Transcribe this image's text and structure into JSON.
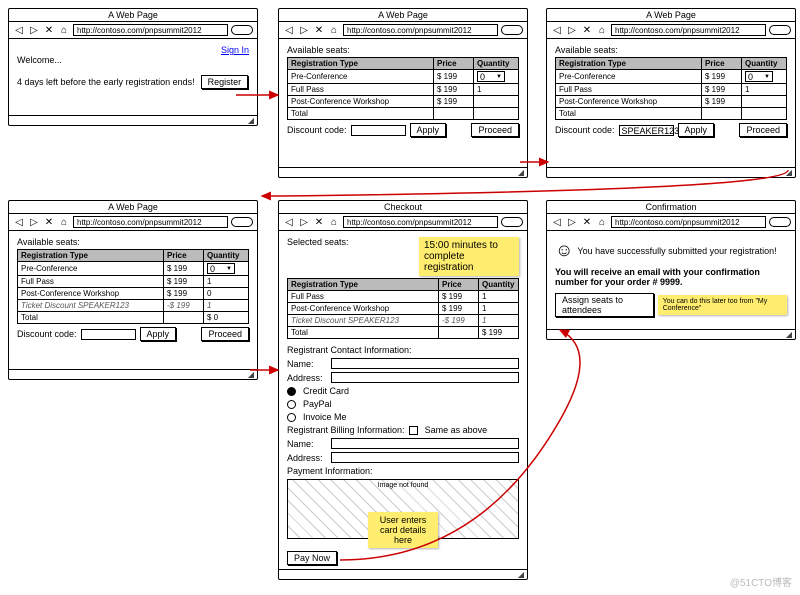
{
  "common": {
    "title_web": "A Web Page",
    "title_checkout": "Checkout",
    "title_confirm": "Confirmation",
    "url": "http://contoso.com/pnpsummit2012",
    "avail": "Available seats:",
    "col_type": "Registration Type",
    "col_price": "Price",
    "col_qty": "Quantity",
    "pre": "Pre-Conference",
    "full": "Full Pass",
    "post": "Post-Conference Workshop",
    "price199": "$ 199",
    "neg199": "-$ 199",
    "total": "Total",
    "discount": "Discount code:",
    "apply": "Apply",
    "proceed": "Proceed",
    "sel0": "0",
    "qty1": "1",
    "ticket_disc": "Ticket Discount SPEAKER123"
  },
  "f1": {
    "welcome": "Welcome...",
    "countdown": "4 days left before the early registration ends!",
    "signin": "Sign In",
    "register": "Register"
  },
  "f3": {
    "code": "SPEAKER123"
  },
  "f4": {
    "total": "$ 0"
  },
  "f5": {
    "selected": "Selected seats:",
    "timer": "15:00 minutes to complete registration",
    "total": "$ 199",
    "reg_contact": "Registrant Contact Information:",
    "name": "Name:",
    "addr": "Address:",
    "cc": "Credit Card",
    "pp": "PayPal",
    "inv": "Invoice Me",
    "billing": "Registrant Billing Information:",
    "same": "Same as above",
    "payinfo": "Payment Information:",
    "noimg": "Image not found",
    "note": "User enters card details here",
    "paynow": "Pay Now"
  },
  "f6": {
    "success": "You have successfully submitted your registration!",
    "email": "You will receive an email with your confirmation number for your order # 9999.",
    "assign": "Assign seats to attendees",
    "later": "You can do this later too from \"My Conference\""
  },
  "watermark": "@51CTO博客"
}
